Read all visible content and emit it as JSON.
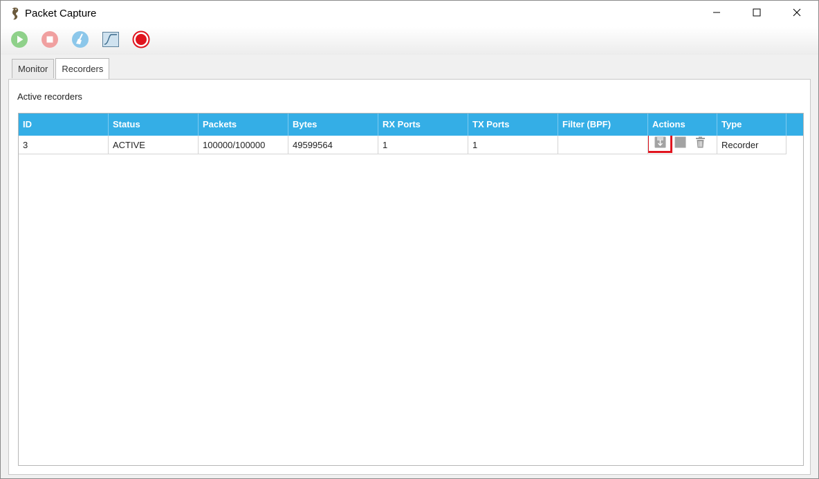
{
  "window": {
    "title": "Packet Capture",
    "icons": {
      "app": "seahorse-icon",
      "minimize": "minimize-icon",
      "maximize": "maximize-icon",
      "close": "close-icon"
    }
  },
  "toolbar": {
    "buttons": [
      {
        "icon": "play-icon",
        "color": "#8fd18a"
      },
      {
        "icon": "stop-icon",
        "color": "#f0a0a0"
      },
      {
        "icon": "broom-icon",
        "color": "#8cc7ea"
      },
      {
        "icon": "graph-icon",
        "color": "#9fc0d8"
      },
      {
        "icon": "record-icon",
        "color": "#e0141e"
      }
    ]
  },
  "tabs": [
    {
      "label": "Monitor",
      "active": false
    },
    {
      "label": "Recorders",
      "active": true
    }
  ],
  "recorders": {
    "section_label": "Active recorders",
    "columns": [
      "ID",
      "Status",
      "Packets",
      "Bytes",
      "RX Ports",
      "TX Ports",
      "Filter (BPF)",
      "Actions",
      "Type"
    ],
    "rows": [
      {
        "id": "3",
        "status": "ACTIVE",
        "packets": "100000/100000",
        "bytes": "49599564",
        "rx_ports": "1",
        "tx_ports": "1",
        "filter": "",
        "actions": [
          "download-icon",
          "stop-square-icon",
          "trash-icon"
        ],
        "type": "Recorder"
      }
    ]
  },
  "colors": {
    "header_bg": "#34aee6",
    "highlight": "#e0141e"
  }
}
